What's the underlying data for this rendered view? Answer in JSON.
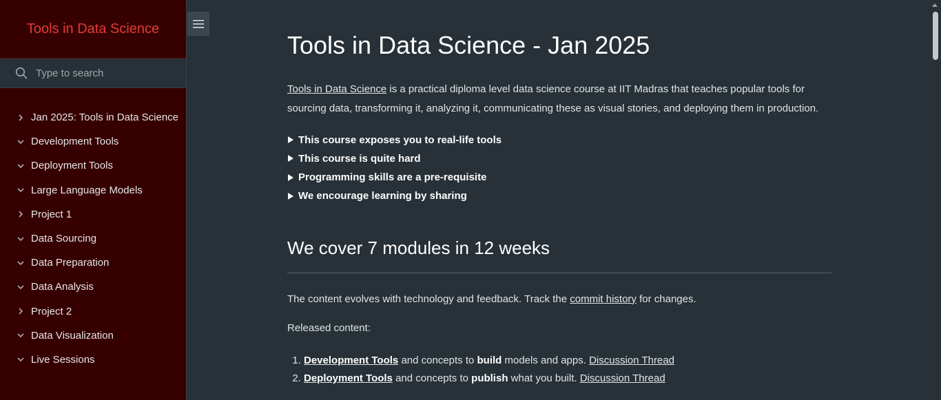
{
  "sidebar": {
    "title": "Tools in Data Science",
    "search_placeholder": "Type to search",
    "items": [
      {
        "label": "Jan 2025: Tools in Data Science",
        "icon": "chevron-right-icon"
      },
      {
        "label": "Development Tools",
        "icon": "chevron-down-icon"
      },
      {
        "label": "Deployment Tools",
        "icon": "chevron-down-icon"
      },
      {
        "label": "Large Language Models",
        "icon": "chevron-down-icon"
      },
      {
        "label": "Project 1",
        "icon": "chevron-right-icon"
      },
      {
        "label": "Data Sourcing",
        "icon": "chevron-down-icon"
      },
      {
        "label": "Data Preparation",
        "icon": "chevron-down-icon"
      },
      {
        "label": "Data Analysis",
        "icon": "chevron-down-icon"
      },
      {
        "label": "Project 2",
        "icon": "chevron-right-icon"
      },
      {
        "label": "Data Visualization",
        "icon": "chevron-down-icon"
      },
      {
        "label": "Live Sessions",
        "icon": "chevron-down-icon"
      }
    ]
  },
  "main": {
    "title": "Tools in Data Science - Jan 2025",
    "intro_link": "Tools in Data Science",
    "intro_text": " is a practical diploma level data science course at IIT Madras that teaches popular tools for sourcing data, transforming it, analyzing it, communicating these as visual stories, and deploying them in production.",
    "details": [
      "This course exposes you to real-life tools",
      "This course is quite hard",
      "Programming skills are a pre-requisite",
      "We encourage learning by sharing"
    ],
    "modules_heading": "We cover 7 modules in 12 weeks",
    "content_text_before": "The content evolves with technology and feedback. Track the ",
    "content_link": "commit history",
    "content_text_after": " for changes.",
    "released_label": "Released content:",
    "released": [
      {
        "link": "Development Tools",
        "mid": " and concepts to ",
        "bold": "build",
        "tail": " models and apps. ",
        "thread": "Discussion Thread"
      },
      {
        "link": "Deployment Tools",
        "mid": " and concepts to ",
        "bold": "publish",
        "tail": " what you built. ",
        "thread": "Discussion Thread"
      }
    ]
  },
  "colors": {
    "sidebar_bg": "#360000",
    "main_bg": "#283137",
    "accent_title": "#e23b35"
  }
}
